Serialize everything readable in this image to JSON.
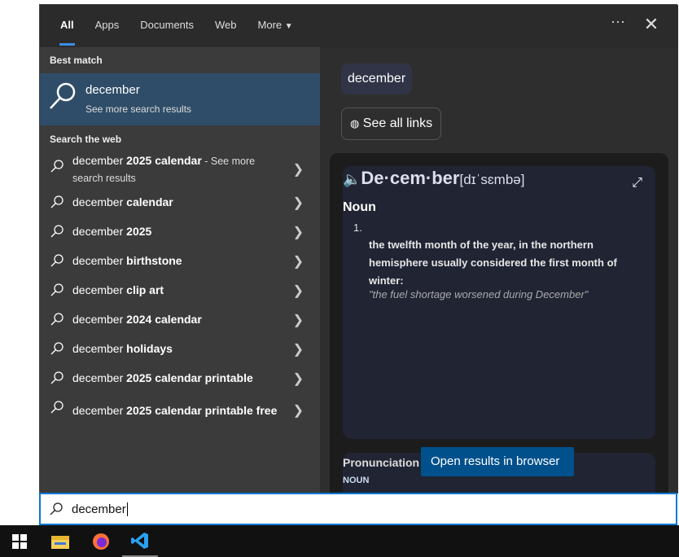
{
  "tabs": [
    {
      "label": "All"
    },
    {
      "label": "Apps"
    },
    {
      "label": "Documents"
    },
    {
      "label": "Web"
    },
    {
      "label": "More"
    }
  ],
  "best_match": {
    "section": "Best match",
    "title": "december",
    "subtitle": "See more search results"
  },
  "web": {
    "section": "Search the web",
    "items": [
      {
        "pre": "december ",
        "bold": "2025 calendar",
        "more": " - See more search results"
      },
      {
        "pre": "december ",
        "bold": "calendar"
      },
      {
        "pre": "december ",
        "bold": "2025"
      },
      {
        "pre": "december ",
        "bold": "birthstone"
      },
      {
        "pre": "december ",
        "bold": "clip art"
      },
      {
        "pre": "december ",
        "bold": "2024 calendar"
      },
      {
        "pre": "december ",
        "bold": "holidays"
      },
      {
        "pre": "december ",
        "bold": "2025 calendar printable"
      },
      {
        "pre": "december ",
        "bold": "2025 calendar printable free"
      }
    ]
  },
  "preview": {
    "query": "december",
    "see_all": "See all links",
    "word": "De·cem·ber",
    "phonetic": "[dɪˈsɛmbə]",
    "pos": "Noun",
    "num": "1.",
    "definition": "the twelfth month of the year, in the northern hemisphere usually considered the first month of winter:",
    "example": "\"the fuel shortage worsened during December\"",
    "pron_title": "Pronunciation",
    "pron_pos": "NOUN"
  },
  "tooltip": "Open results in browser",
  "search": {
    "value": "december"
  },
  "colors": {
    "accent": "#0a78d4",
    "highlight": "#2f4d68"
  }
}
